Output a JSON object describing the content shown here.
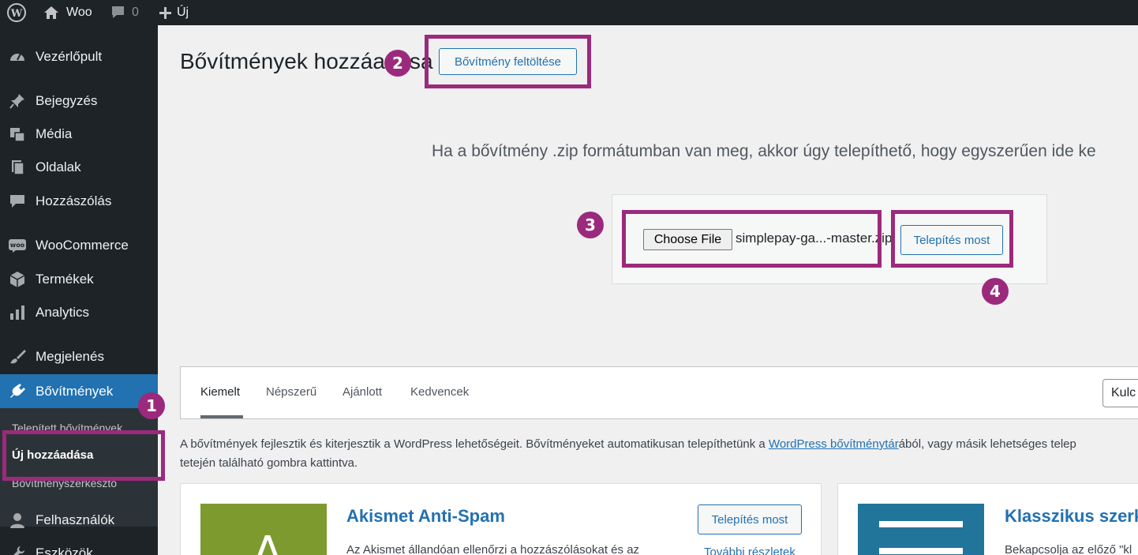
{
  "adminbar": {
    "site_name": "Woo",
    "comments_count": "0",
    "new_label": "Új"
  },
  "sidebar": {
    "items": [
      {
        "label": "Vezérlőpult",
        "icon": "dashboard-icon"
      },
      {
        "label": "Bejegyzés",
        "icon": "pin-icon"
      },
      {
        "label": "Média",
        "icon": "media-icon"
      },
      {
        "label": "Oldalak",
        "icon": "pages-icon"
      },
      {
        "label": "Hozzászólás",
        "icon": "comments-icon"
      },
      {
        "label": "WooCommerce",
        "icon": "woo-icon"
      },
      {
        "label": "Termékek",
        "icon": "box-icon"
      },
      {
        "label": "Analytics",
        "icon": "bar-chart-icon"
      },
      {
        "label": "Megjelenés",
        "icon": "brush-icon"
      },
      {
        "label": "Bővítmények",
        "icon": "plugin-icon"
      },
      {
        "label": "Felhasználók",
        "icon": "user-icon"
      },
      {
        "label": "Eszközök",
        "icon": "wrench-icon"
      }
    ],
    "submenu": [
      "Telepített bővítmények",
      "Új hozzáadása",
      "Bővítményszerkesztő"
    ]
  },
  "main": {
    "title": "Bővítmények hozzáadása",
    "upload_button": "Bővítmény feltöltése",
    "upload_description": "Ha a bővítmény .zip formátumban van meg, akkor úgy telepíthető, hogy egyszerűen ide ke",
    "choose_file_label": "Choose File",
    "file_name": "simplepay-ga...-master.zip",
    "install_now": "Telepítés most"
  },
  "callouts": [
    "1",
    "2",
    "3",
    "4"
  ],
  "filter": {
    "tabs": [
      "Kiemelt",
      "Népszerű",
      "Ajánlott",
      "Kedvencek"
    ],
    "search_value": "Kulc"
  },
  "intro": {
    "part1": "A bővítmények fejlesztik és kiterjesztik a WordPress lehetőségeit. Bővítményeket automatikusan telepíthetünk a ",
    "link": "WordPress bővítménytár",
    "part2": "ából, vagy másik lehetséges telep",
    "line2": "tetején található gombra kattintva."
  },
  "cards": [
    {
      "title": "Akismet Anti-Spam",
      "desc": "Az Akismet állandóan ellenőrzi a hozzászólásokat és az",
      "install": "Telepítés most",
      "more": "További részletek",
      "thumb_letter": "A",
      "thumb_color": "#7d9a2e"
    },
    {
      "title": "Klasszikus szerke",
      "desc": "Bekapcsolja az előző \"kl",
      "thumb_color": "#21759b"
    }
  ],
  "colors": {
    "accent": "#2271b1",
    "callout": "#9b2a7c",
    "admin_dark": "#1d2327"
  }
}
